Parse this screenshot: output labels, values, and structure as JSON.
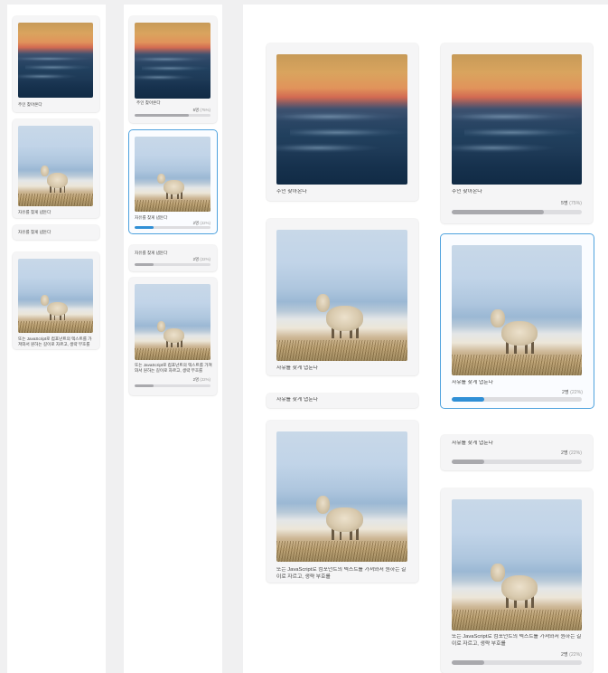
{
  "options": [
    {
      "image": "sunset-sea-photo",
      "label": "주인 찾아온다",
      "votes": "5명",
      "percent": "(75%)",
      "fraction": 0.71
    },
    {
      "image": "sheep-meadow-photo",
      "label": "자유를 찾게 냅둔다",
      "votes": "2명",
      "percent": "(22%)",
      "fraction": 0.25,
      "selected": true
    },
    {
      "image": "",
      "label": "자유를 찾게 냅둔다",
      "votes": "2명",
      "percent": "(22%)",
      "fraction": 0.25
    },
    {
      "image": "sheep-meadow-photo",
      "label": "또는 JavaScript로 컴포넌트의 텍스트를 가져와서 원하는 길이로 자르고, 생략 부호를",
      "votes": "2명",
      "percent": "(22%)",
      "fraction": 0.25
    }
  ],
  "colors": {
    "selected_outline": "#4ea2de",
    "selected_fill": "#2f8fd6",
    "bar_fill": "#a9a9ad",
    "bar_track": "#dddde0",
    "card_background": "#f5f5f6"
  }
}
